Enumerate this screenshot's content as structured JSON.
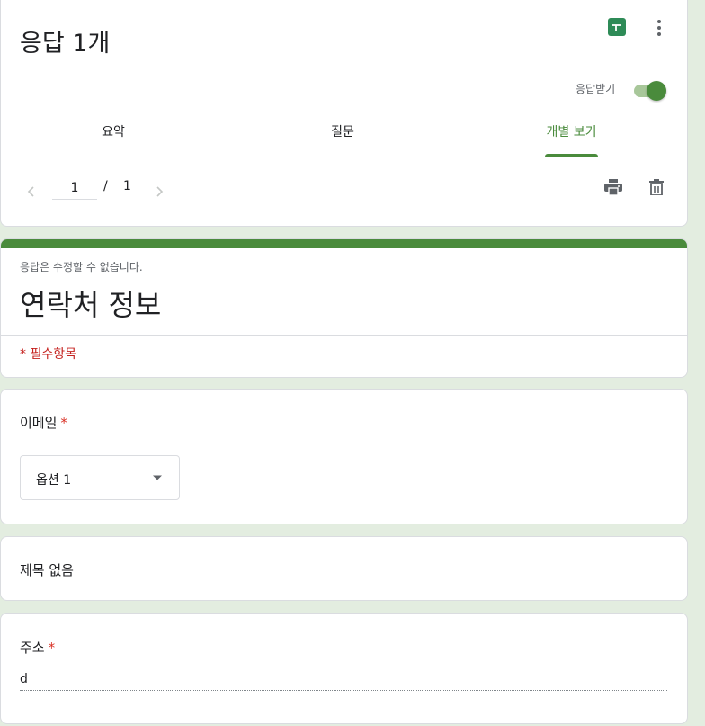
{
  "responses": {
    "title": "응답 1개",
    "accepting_label": "응답받기",
    "accepting": true,
    "tabs": [
      {
        "label": "요약",
        "active": false
      },
      {
        "label": "질문",
        "active": false
      },
      {
        "label": "개별 보기",
        "active": true
      }
    ],
    "pager": {
      "current": "1",
      "separator": "/",
      "total": "1"
    }
  },
  "form": {
    "readonly_note": "응답은 수정할 수 없습니다.",
    "title": "연락처 정보",
    "required_note": "* 필수항목"
  },
  "questions": [
    {
      "title": "이메일",
      "required": "*",
      "type": "dropdown",
      "answer": "옵션 1"
    },
    {
      "title": "제목 없음",
      "type": "section"
    },
    {
      "title": "주소",
      "required": "*",
      "type": "text",
      "answer": "d"
    }
  ],
  "icons": {
    "sheets": "google-sheets-icon",
    "more": "more-vert-icon",
    "prev": "chevron-left-icon",
    "next": "chevron-right-icon",
    "print": "print-icon",
    "delete": "trash-icon",
    "dropdown": "caret-down-icon"
  },
  "colors": {
    "background": "#e3ede0",
    "accent": "#4a8b3c",
    "sheets": "#2e8b57",
    "required": "#d93025"
  }
}
